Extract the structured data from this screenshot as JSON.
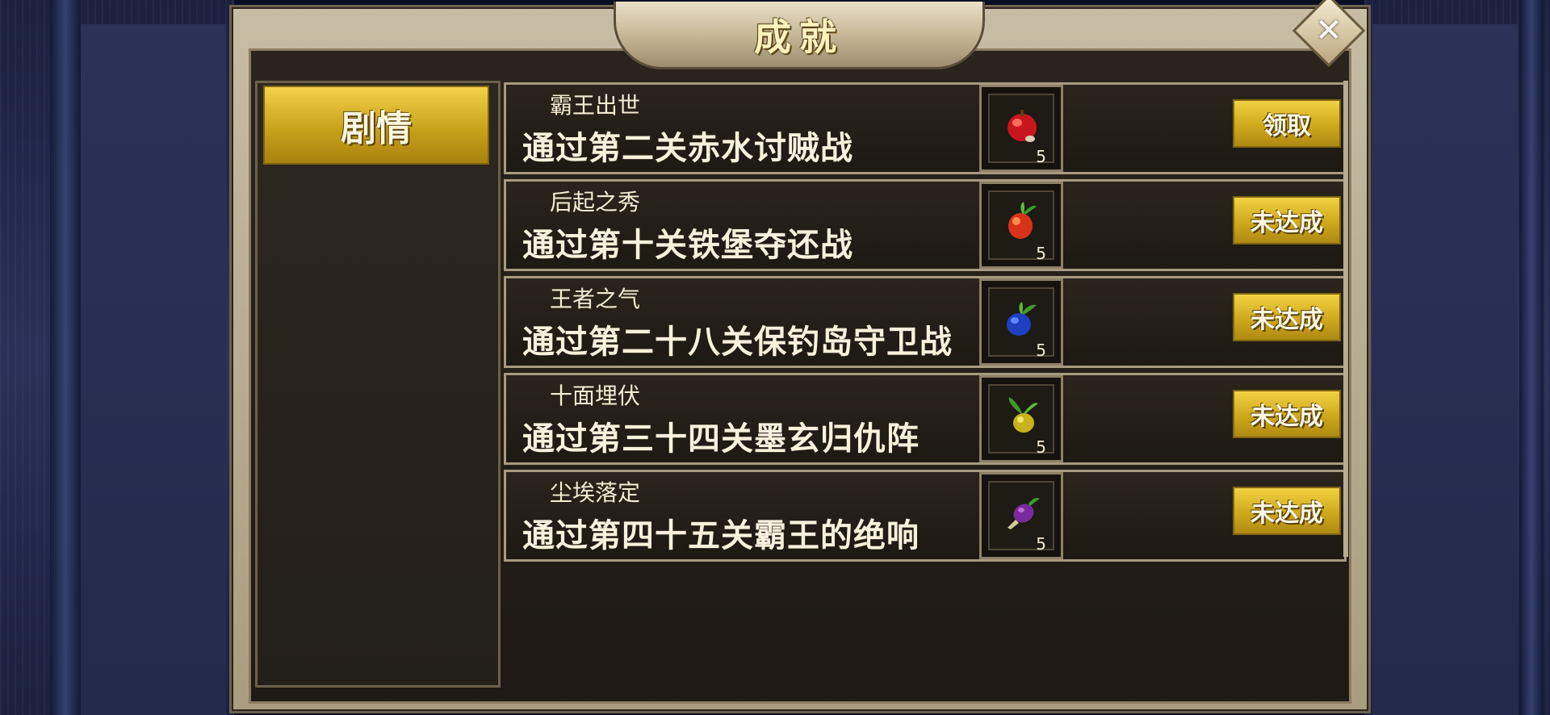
{
  "dialog": {
    "title": "成就",
    "close_label": "✕"
  },
  "categories": [
    {
      "label": "剧情",
      "selected": true
    }
  ],
  "achievements": [
    {
      "name": "霸王出世",
      "desc": "通过第二关赤水讨贼战",
      "reward_count": "5",
      "reward_icon": "red-apple-icon",
      "action": "领取"
    },
    {
      "name": "后起之秀",
      "desc": "通过第十关铁堡夺还战",
      "reward_count": "5",
      "reward_icon": "red-radish-icon",
      "action": "未达成"
    },
    {
      "name": "王者之气",
      "desc": "通过第二十八关保钓岛守卫战",
      "reward_count": "5",
      "reward_icon": "blue-berry-icon",
      "action": "未达成"
    },
    {
      "name": "十面埋伏",
      "desc": "通过第三十四关墨玄归仇阵",
      "reward_count": "5",
      "reward_icon": "yellow-fruit-icon",
      "action": "未达成"
    },
    {
      "name": "尘埃落定",
      "desc": "通过第四十五关霸王的绝响",
      "reward_count": "5",
      "reward_icon": "purple-eggplant-icon",
      "action": "未达成"
    }
  ]
}
